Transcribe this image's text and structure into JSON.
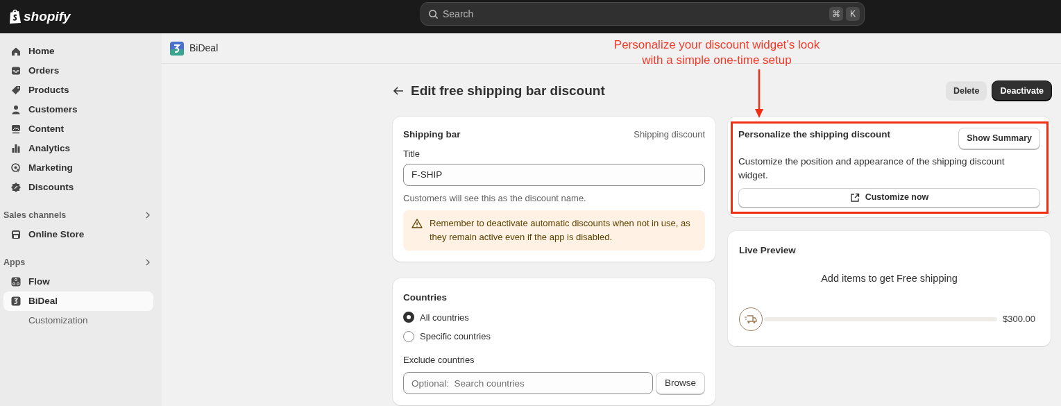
{
  "topbar": {
    "logo": "shopify",
    "search": {
      "placeholder": "Search"
    },
    "shortcut_keys": [
      "⌘",
      "K"
    ]
  },
  "sidebar": {
    "items": [
      {
        "label": "Home",
        "selected": false
      },
      {
        "label": "Orders",
        "selected": false
      },
      {
        "label": "Products",
        "selected": false
      },
      {
        "label": "Customers",
        "selected": false
      },
      {
        "label": "Content",
        "selected": false
      },
      {
        "label": "Analytics",
        "selected": false
      },
      {
        "label": "Marketing",
        "selected": false
      },
      {
        "label": "Discounts",
        "selected": false
      }
    ],
    "sections": [
      {
        "title": "Sales channels",
        "items": [
          {
            "label": "Online Store",
            "selected": false
          }
        ]
      },
      {
        "title": "Apps",
        "items": [
          {
            "label": "Flow",
            "selected": false
          },
          {
            "label": "BiDeal",
            "selected": true,
            "children": [
              {
                "label": "Customization",
                "selected": false
              }
            ]
          }
        ]
      }
    ]
  },
  "app_header": {
    "title": "BiDeal"
  },
  "page": {
    "title": "Edit free shipping bar discount",
    "actions": [
      {
        "label": "Delete",
        "kind": "secondary"
      },
      {
        "label": "Deactivate",
        "kind": "primary"
      }
    ]
  },
  "shipping_card": {
    "title": "Shipping bar",
    "subtitle": "Shipping discount",
    "field_label": "Title",
    "value": "F-SHIP",
    "help": "Customers will see this as the discount name.",
    "warning": "Remember to deactivate automatic discounts when not in use, as they remain active even if the app is disabled."
  },
  "countries_card": {
    "title": "Countries",
    "options": [
      {
        "label": "All countries",
        "selected": true
      },
      {
        "label": "Specific countries",
        "selected": false
      }
    ],
    "exclude_label": "Exclude countries",
    "exclude_placeholder": "Optional:  Search countries",
    "browse_button": "Browse"
  },
  "personalize_card": {
    "title": "Personalize the shipping discount",
    "summary_button": "Show Summary",
    "description": "Customize the position and appearance of the shipping discount widget.",
    "customize_button": "Customize now"
  },
  "preview_card": {
    "title": "Live Preview",
    "message": "Add items to get Free shipping",
    "level": 0,
    "amount": "$300.00"
  },
  "annotation": {
    "lines": [
      "Personalize your discount widget’s look",
      "with a simple one-time setup"
    ]
  }
}
